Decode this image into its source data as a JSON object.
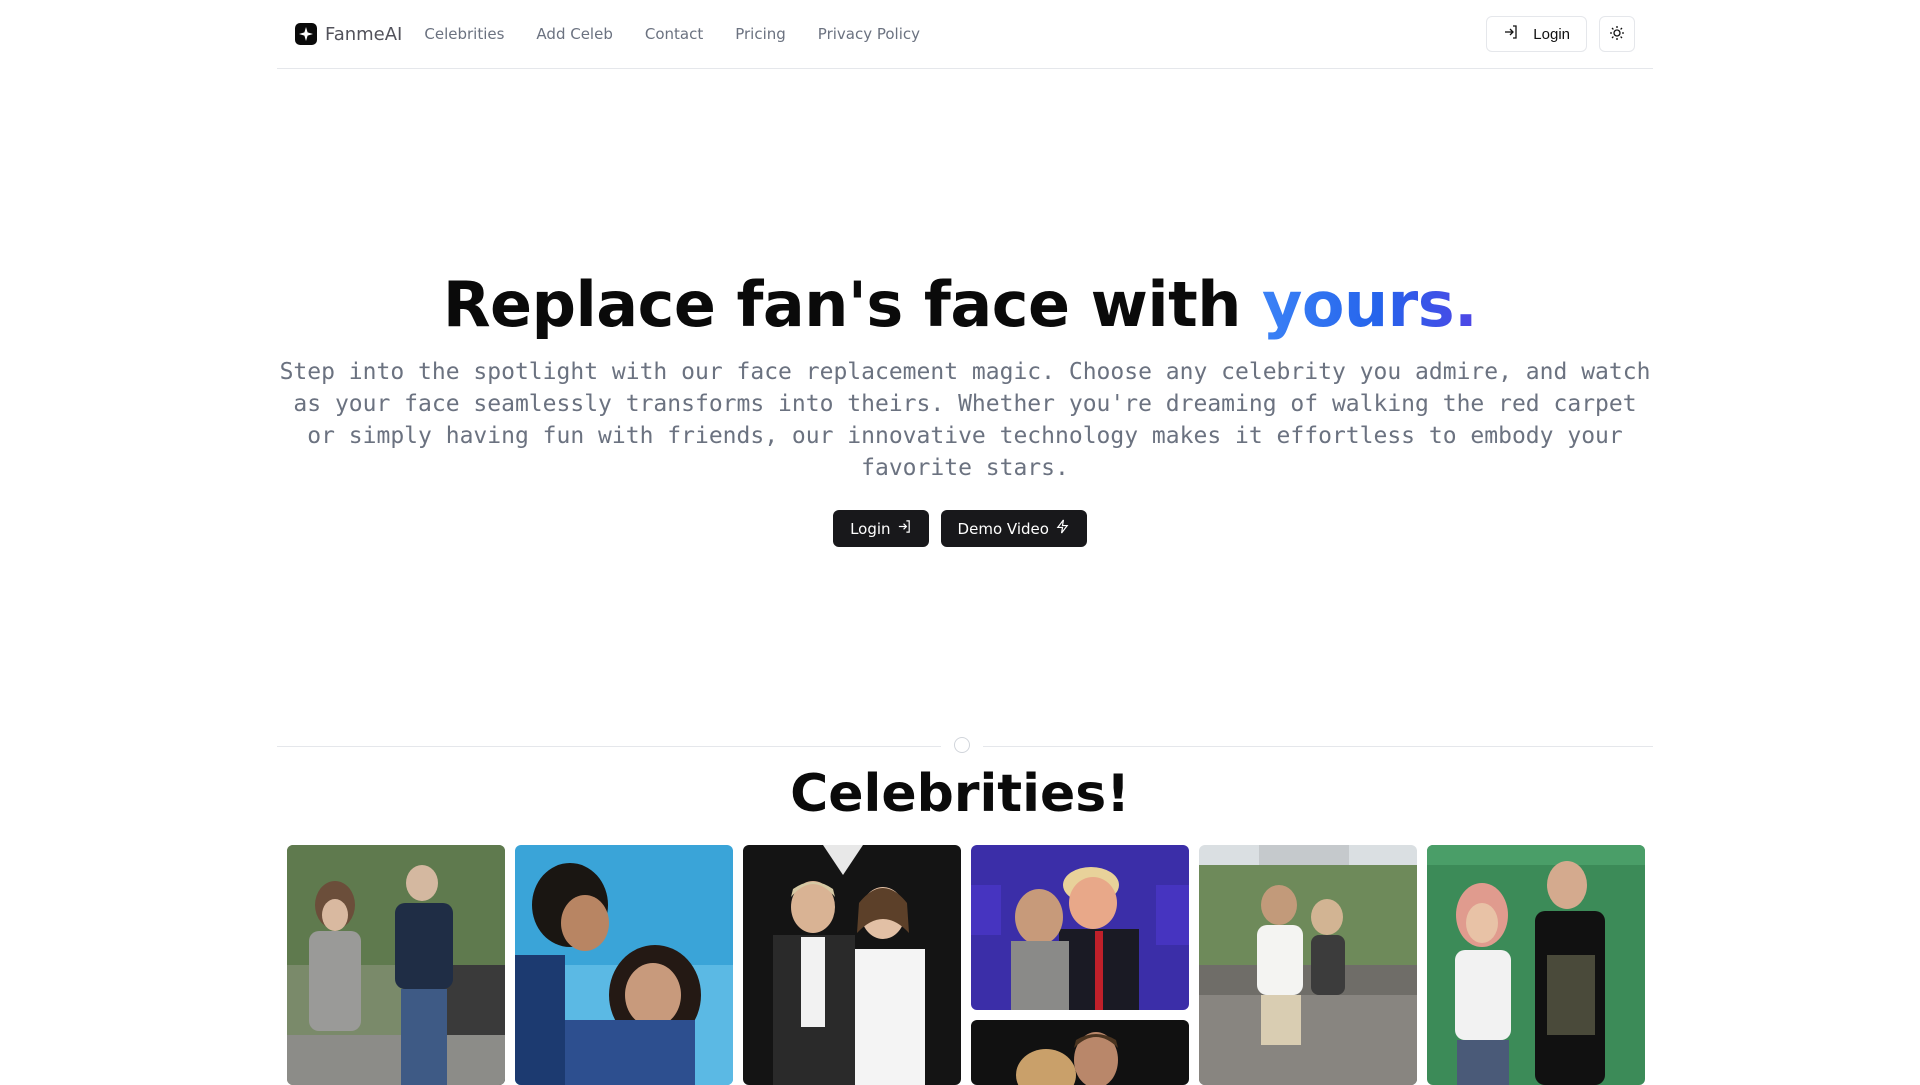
{
  "brand": {
    "name": "FanmeAI"
  },
  "nav": {
    "items": [
      "Celebrities",
      "Add Celeb",
      "Contact",
      "Pricing",
      "Privacy Policy"
    ]
  },
  "header": {
    "login_label": "Login"
  },
  "hero": {
    "title_main": "Replace fan's face with ",
    "title_accent": "yours.",
    "subtitle": "Step into the spotlight with our face replacement magic. Choose any celebrity you admire, and watch as your face seamlessly transforms into theirs. Whether you're dreaming of walking the red carpet or simply having fun with friends, our innovative technology makes it effortless to embody your favorite stars.",
    "login_button": "Login",
    "demo_button": "Demo Video"
  },
  "celebrities": {
    "title": "Celebrities!"
  },
  "colors": {
    "accent_start": "#3b82f6",
    "accent_end": "#4f46e5",
    "button_dark": "#18181b"
  }
}
